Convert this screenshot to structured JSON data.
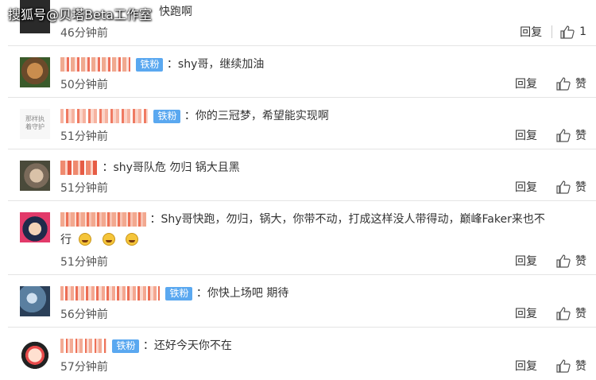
{
  "watermark": "搜狐号@贝塔Beta工作室",
  "colors": {
    "badge": "#5aa8f0",
    "divider": "#e4e4e4"
  },
  "comments": [
    {
      "content": "快跑啊",
      "time": "46分钟前",
      "reply": "回复",
      "like": "1"
    },
    {
      "badge": "铁粉",
      "content": "：shy哥，继续加油",
      "time": "50分钟前",
      "reply": "回复",
      "like": "赞"
    },
    {
      "badge": "铁粉",
      "content": "：你的三冠梦，希望能实现啊",
      "time": "51分钟前",
      "reply": "回复",
      "like": "赞",
      "avatar_text": "那样执\n着守护"
    },
    {
      "content": "：shy哥队危 勿归 锅大且黑",
      "time": "51分钟前",
      "reply": "回复",
      "like": "赞"
    },
    {
      "content_line1": "：Shy哥快跑，勿归，锅大，你带不动，打成这样没人带得动，巅峰Faker来也不",
      "content_line2": "行",
      "time": "51分钟前",
      "reply": "回复",
      "like": "赞"
    },
    {
      "badge": "铁粉",
      "content": "：你快上场吧 期待",
      "time": "56分钟前",
      "reply": "回复",
      "like": "赞"
    },
    {
      "badge": "铁粉",
      "content": "：还好今天你不在",
      "time": "57分钟前",
      "reply": "回复",
      "like": "赞"
    }
  ]
}
